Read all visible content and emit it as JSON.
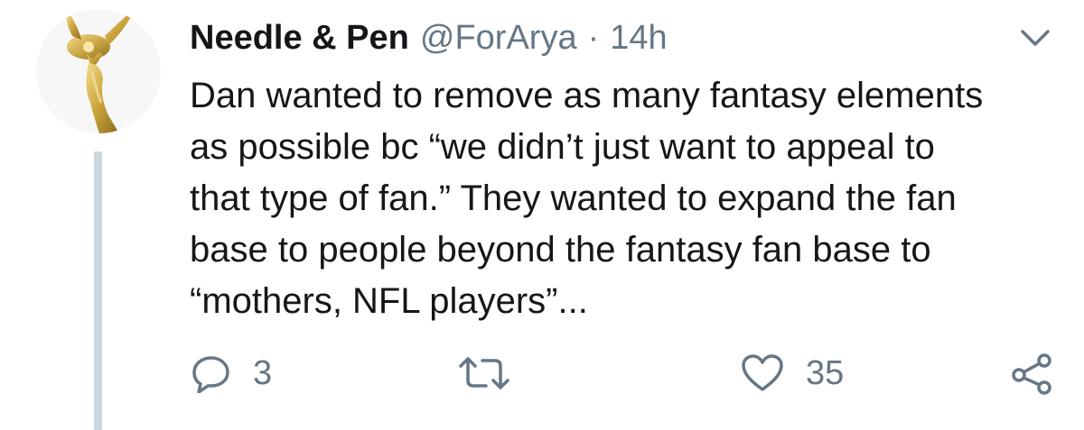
{
  "tweet": {
    "author_name": "Needle & Pen",
    "handle": "@ForArya",
    "separator": "·",
    "time": "14h",
    "text": "Dan wanted to remove as many fantasy elements\nas possible bc “we didn’t just want to appeal to\nthat type of fan.” They wanted to expand the fan\nbase to people beyond the fantasy fan base to\n“mothers, NFL players”...",
    "avatar_icon": "emmy-statuette-icon",
    "menu_icon": "chevron-down-icon"
  },
  "actions": {
    "reply": {
      "icon": "reply-icon",
      "count": "3"
    },
    "retweet": {
      "icon": "retweet-icon",
      "count": ""
    },
    "like": {
      "icon": "heart-icon",
      "count": "35"
    },
    "share": {
      "icon": "share-icon"
    }
  },
  "colors": {
    "text": "#14171a",
    "muted": "#657786",
    "thread_line": "#ccd6dd",
    "statuette_gold": "#c9a23a"
  }
}
